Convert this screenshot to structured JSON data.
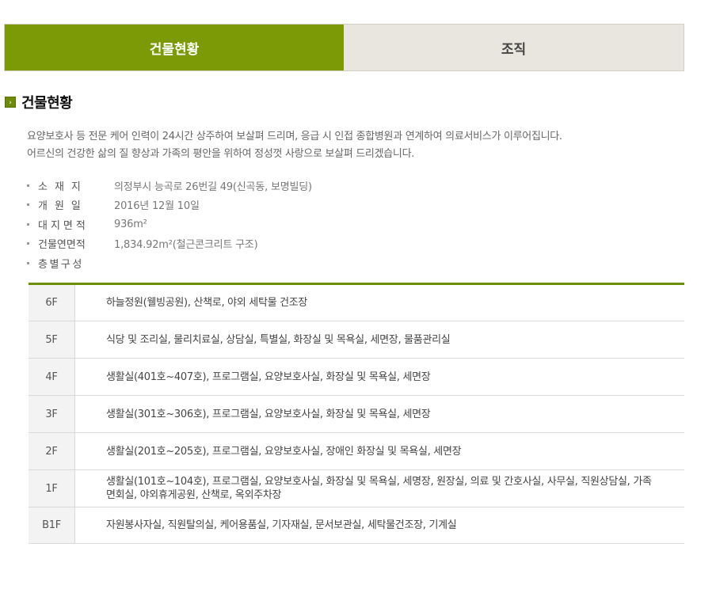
{
  "tabs": [
    {
      "label": "건물현황",
      "active": true
    },
    {
      "label": "조직",
      "active": false
    }
  ],
  "section": {
    "title": "건물현황"
  },
  "intro": {
    "line1": "요양보호사 등 전문 케어 인력이 24시간 상주하여 보살펴 드리며, 응급 시 인접 종합병원과 연계하여 의료서비스가 이루어집니다.",
    "line2": "어르신의 건강한 삶의 질 향상과 가족의 평안을 위하여 정성껏 사랑으로 보살펴 드리겠습니다."
  },
  "info": [
    {
      "label": "소재지",
      "value": "의정부시 능곡로 26번길 49(신곡동, 보명빌딩)"
    },
    {
      "label": "개원일",
      "value": "2016년 12월 10일"
    },
    {
      "label": "대지면적",
      "value": "936m²"
    },
    {
      "label": "건물연면적",
      "value": "1,834.92m²(철근콘크리트 구조)"
    },
    {
      "label": "층별구성",
      "value": ""
    }
  ],
  "floors": [
    {
      "floor": "6F",
      "desc": "하늘정원(웰빙공원), 산책로, 야외 세탁물 건조장"
    },
    {
      "floor": "5F",
      "desc": "식당 및 조리실, 물리치료실, 상담실, 특별실, 화장실 및 목욕실, 세면장, 물품관리실"
    },
    {
      "floor": "4F",
      "desc": "생활실(401호~407호), 프로그램실, 요양보호사실, 화장실 및 목욕실, 세면장"
    },
    {
      "floor": "3F",
      "desc": "생활실(301호~306호), 프로그램실, 요양보호사실, 화장실 및 목욕실, 세면장"
    },
    {
      "floor": "2F",
      "desc": "생활실(201호~205호), 프로그램실, 요양보호사실, 장애인 화장실 및 목욕실, 세면장"
    },
    {
      "floor": "1F",
      "desc": "생활실(101호~104호), 프로그램실, 요양보호사실, 화장실 및 목욕실, 세명장, 원장실, 의료 및 간호사실, 사무실, 직원상담실, 가족면회실, 야외휴게공원, 산책로, 옥외주차장"
    },
    {
      "floor": "B1F",
      "desc": "자원봉사자실, 직원탈의실, 케어용품실, 기자재실, 문서보관실, 세탁물건조장, 기계실"
    }
  ]
}
